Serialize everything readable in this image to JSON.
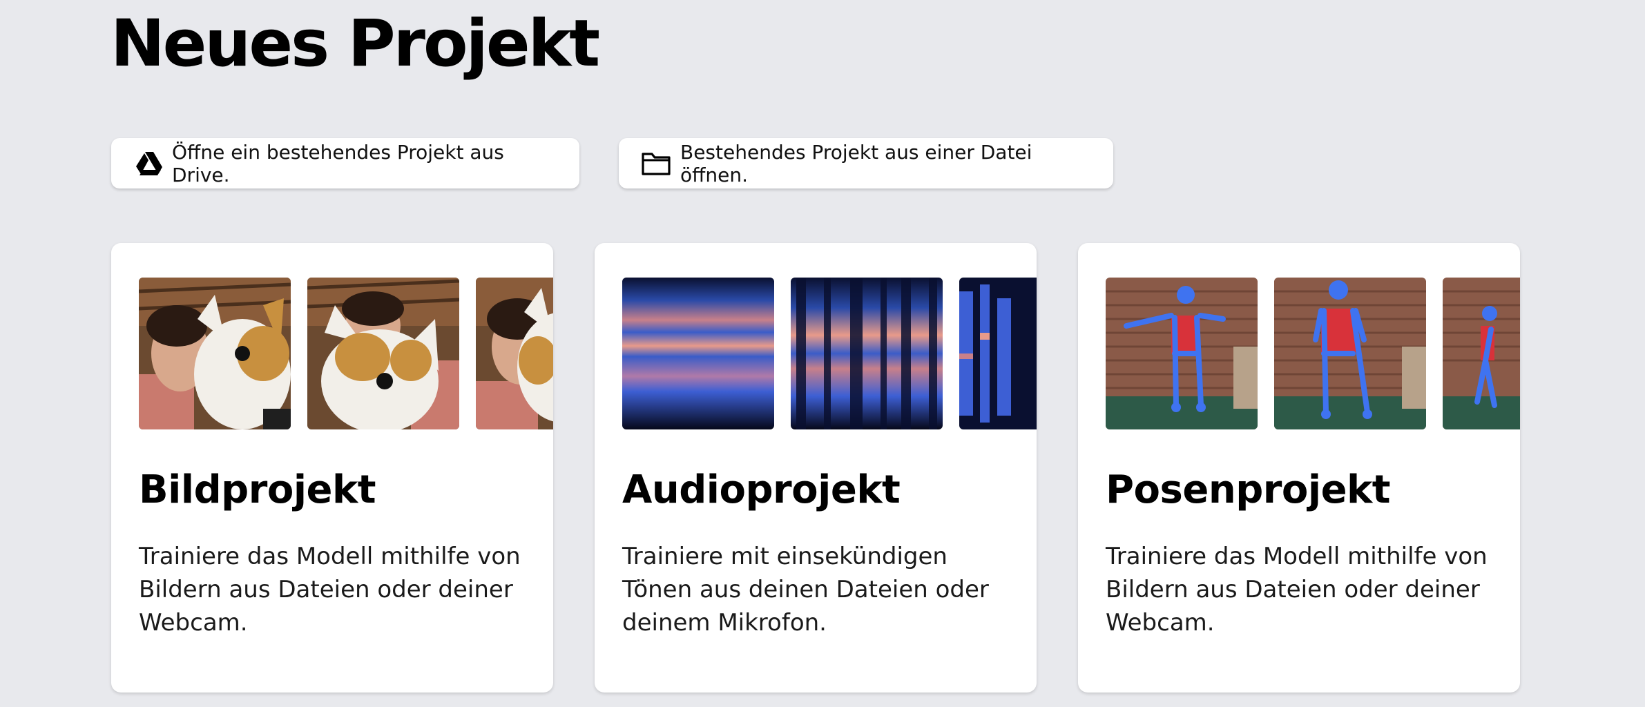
{
  "page": {
    "title": "Neues Projekt"
  },
  "open_options": {
    "drive_label": "Öffne ein bestehendes Projekt aus Drive.",
    "file_label": "Bestehendes Projekt aus einer Datei öffnen."
  },
  "cards": [
    {
      "title": "Bildprojekt",
      "description": "Trainiere das Modell mithilfe von Bildern aus Dateien oder deiner Webcam."
    },
    {
      "title": "Audioprojekt",
      "description": "Trainiere mit einsekündigen Tönen aus deinen Dateien oder deinem Mikrofon."
    },
    {
      "title": "Posenprojekt",
      "description": "Trainiere das Modell mithilfe von Bildern aus Dateien oder deiner Webcam."
    }
  ],
  "icons": {
    "drive": "google-drive-icon",
    "folder": "folder-icon"
  },
  "colors": {
    "background": "#e8e9ed",
    "card": "#ffffff",
    "pose_skeleton": "#3f73f0",
    "spectrogram_low": "#0a1030",
    "spectrogram_high": "#f0a08a"
  }
}
